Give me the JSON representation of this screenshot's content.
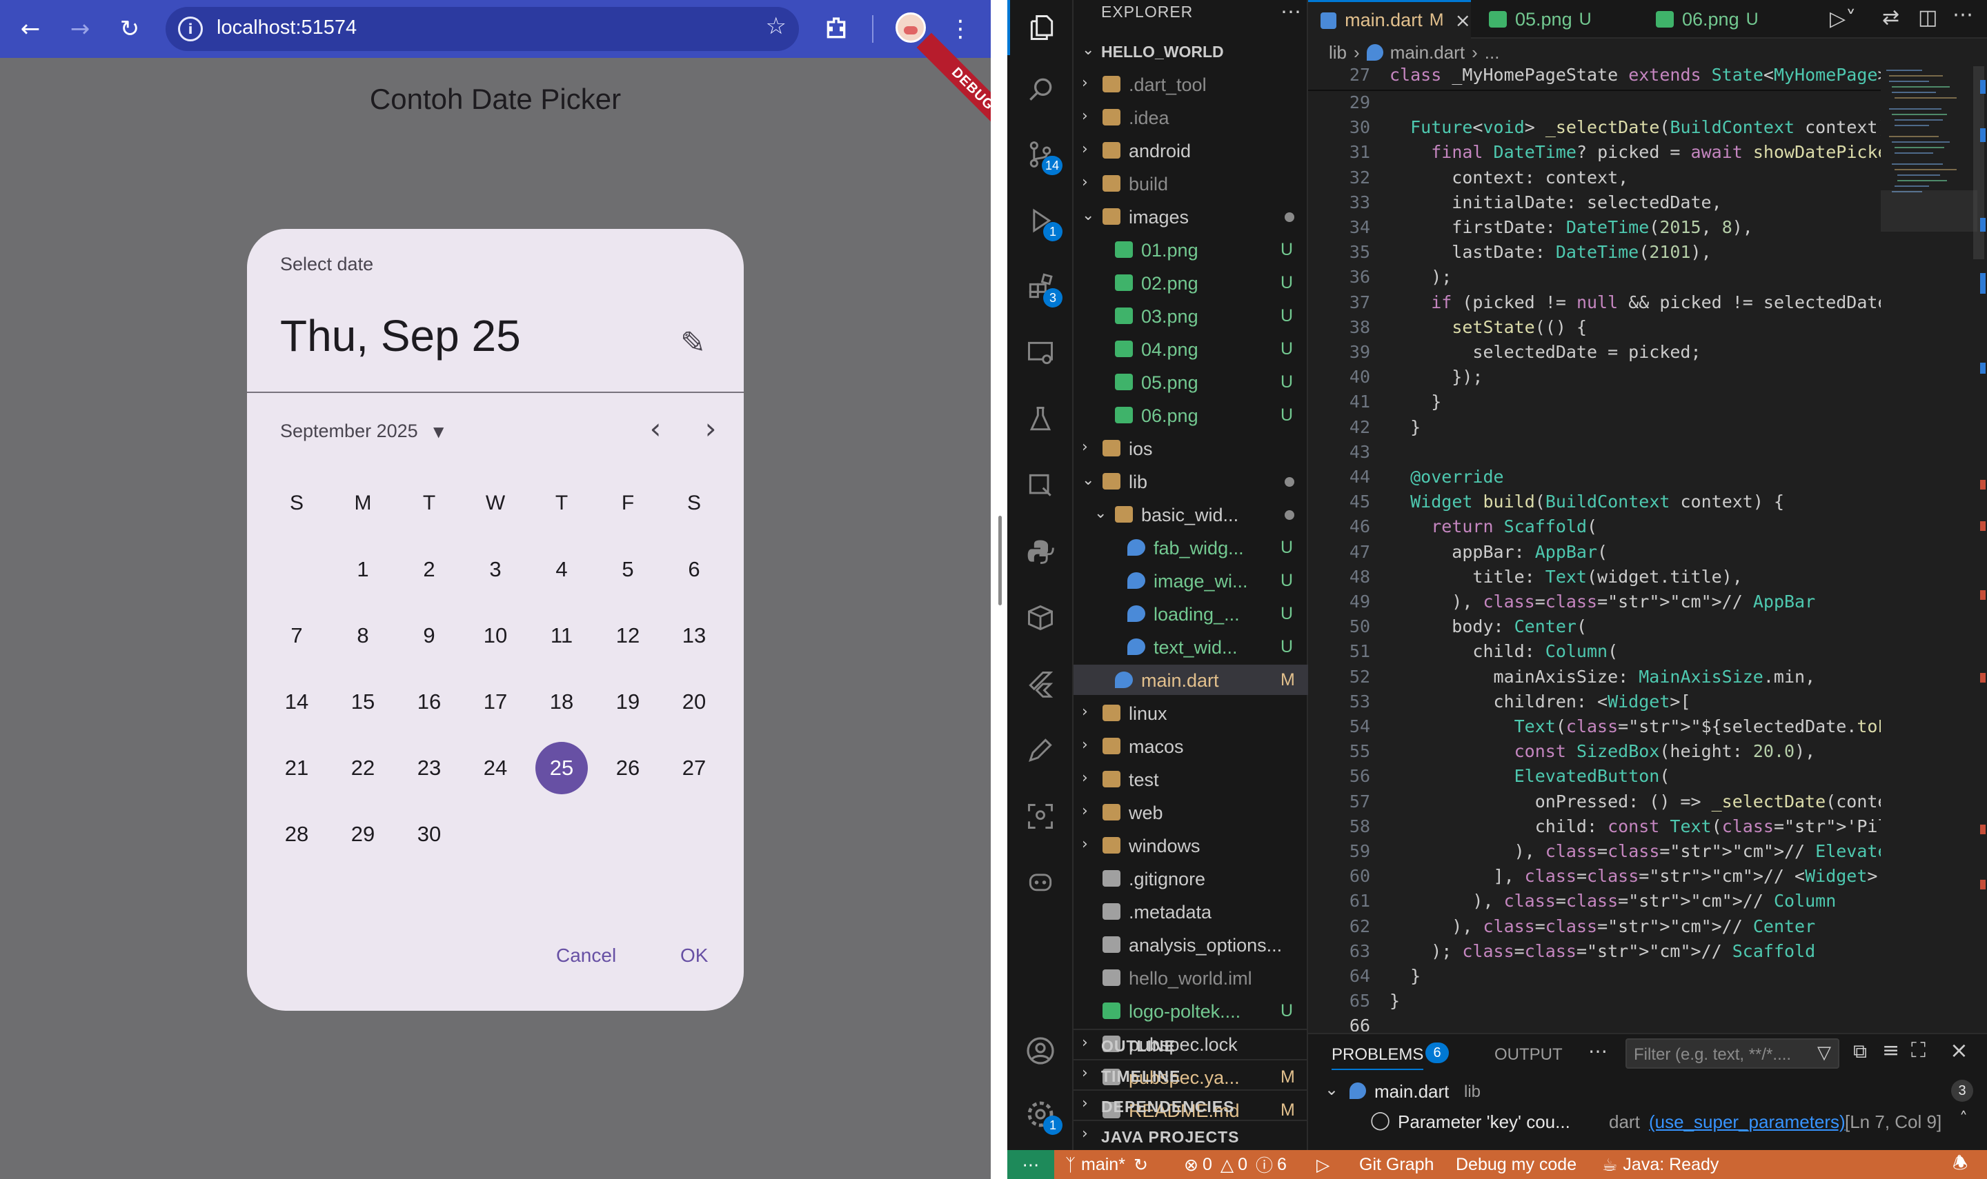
{
  "browser": {
    "url": "localhost:51574",
    "app_title": "Contoh Date Picker",
    "debug_label": "DEBUG",
    "icons": [
      "back-icon",
      "forward-icon",
      "reload-icon",
      "site-info-icon",
      "star-icon",
      "extensions-icon",
      "profile-avatar",
      "menu-icon"
    ]
  },
  "date_picker": {
    "heading": "Select date",
    "selected_display": "Thu, Sep 25",
    "month_label": "September 2025",
    "weekdays": [
      "S",
      "M",
      "T",
      "W",
      "T",
      "F",
      "S"
    ],
    "days": [
      "",
      "1",
      "2",
      "3",
      "4",
      "5",
      "6",
      "7",
      "8",
      "9",
      "10",
      "11",
      "12",
      "13",
      "14",
      "15",
      "16",
      "17",
      "18",
      "19",
      "20",
      "21",
      "22",
      "23",
      "24",
      "25",
      "26",
      "27",
      "28",
      "29",
      "30"
    ],
    "selected_day": "25",
    "cancel_label": "Cancel",
    "ok_label": "OK",
    "accent_color": "#6750a4"
  },
  "vscode": {
    "explorer_title": "EXPLORER",
    "root": "HELLO_WORLD",
    "activity_badges": {
      "source_control": "14",
      "run": "1",
      "extensions": "3",
      "settings": "1"
    },
    "tree": [
      {
        "label": ".dart_tool",
        "type": "folder",
        "badge": ""
      },
      {
        "label": ".idea",
        "type": "folder",
        "badge": ""
      },
      {
        "label": "android",
        "type": "folder",
        "badge": ""
      },
      {
        "label": "build",
        "type": "folder",
        "badge": ""
      },
      {
        "label": "images",
        "type": "folder-open",
        "badge": "dot"
      },
      {
        "label": "01.png",
        "type": "image",
        "badge": "U"
      },
      {
        "label": "02.png",
        "type": "image",
        "badge": "U"
      },
      {
        "label": "03.png",
        "type": "image",
        "badge": "U"
      },
      {
        "label": "04.png",
        "type": "image",
        "badge": "U"
      },
      {
        "label": "05.png",
        "type": "image",
        "badge": "U"
      },
      {
        "label": "06.png",
        "type": "image",
        "badge": "U"
      },
      {
        "label": "ios",
        "type": "folder",
        "badge": ""
      },
      {
        "label": "lib",
        "type": "folder-open",
        "badge": "dot"
      },
      {
        "label": "basic_wid...",
        "type": "folder-open",
        "badge": "dot"
      },
      {
        "label": "fab_widg...",
        "type": "dart",
        "badge": "U"
      },
      {
        "label": "image_wi...",
        "type": "dart",
        "badge": "U"
      },
      {
        "label": "loading_...",
        "type": "dart",
        "badge": "U"
      },
      {
        "label": "text_wid...",
        "type": "dart",
        "badge": "U"
      },
      {
        "label": "main.dart",
        "type": "dart",
        "badge": "M"
      },
      {
        "label": "linux",
        "type": "folder",
        "badge": ""
      },
      {
        "label": "macos",
        "type": "folder",
        "badge": ""
      },
      {
        "label": "test",
        "type": "folder",
        "badge": ""
      },
      {
        "label": "web",
        "type": "folder",
        "badge": ""
      },
      {
        "label": "windows",
        "type": "folder",
        "badge": ""
      },
      {
        "label": ".gitignore",
        "type": "file",
        "badge": ""
      },
      {
        "label": ".metadata",
        "type": "file",
        "badge": ""
      },
      {
        "label": "analysis_options...",
        "type": "file",
        "badge": ""
      },
      {
        "label": "hello_world.iml",
        "type": "file",
        "badge": ""
      },
      {
        "label": "logo-poltek....",
        "type": "image",
        "badge": "U"
      },
      {
        "label": "pubspec.lock",
        "type": "file",
        "badge": ""
      },
      {
        "label": "pubspec.ya...",
        "type": "file",
        "badge": "M"
      },
      {
        "label": "README.md",
        "type": "file",
        "badge": "M"
      }
    ],
    "sections": [
      "OUTLINE",
      "TIMELINE",
      "DEPENDENCIES",
      "JAVA PROJECTS"
    ],
    "tabs": [
      {
        "label": "main.dart",
        "status": "M"
      },
      {
        "label": "05.png",
        "status": "U"
      },
      {
        "label": "06.png",
        "status": "U"
      }
    ],
    "breadcrumb": [
      "lib",
      "main.dart",
      "..."
    ],
    "sticky_line": {
      "num": "27",
      "text": "class _MyHomePageState extends State<MyHomePage>"
    },
    "code_lines": [
      {
        "num": "29",
        "text": ""
      },
      {
        "num": "30",
        "text": "  Future<void> _selectDate(BuildContext context)"
      },
      {
        "num": "31",
        "text": "    final DateTime? picked = await showDatePicker"
      },
      {
        "num": "32",
        "text": "      context: context,"
      },
      {
        "num": "33",
        "text": "      initialDate: selectedDate,"
      },
      {
        "num": "34",
        "text": "      firstDate: DateTime(2015, 8),"
      },
      {
        "num": "35",
        "text": "      lastDate: DateTime(2101),"
      },
      {
        "num": "36",
        "text": "    );"
      },
      {
        "num": "37",
        "text": "    if (picked != null && picked != selectedDate)"
      },
      {
        "num": "38",
        "text": "      setState(() {"
      },
      {
        "num": "39",
        "text": "        selectedDate = picked;"
      },
      {
        "num": "40",
        "text": "      });"
      },
      {
        "num": "41",
        "text": "    }"
      },
      {
        "num": "42",
        "text": "  }"
      },
      {
        "num": "43",
        "text": ""
      },
      {
        "num": "44",
        "text": "  @override"
      },
      {
        "num": "45",
        "text": "  Widget build(BuildContext context) {"
      },
      {
        "num": "46",
        "text": "    return Scaffold("
      },
      {
        "num": "47",
        "text": "      appBar: AppBar("
      },
      {
        "num": "48",
        "text": "        title: Text(widget.title),"
      },
      {
        "num": "49",
        "text": "      ), // AppBar"
      },
      {
        "num": "50",
        "text": "      body: Center("
      },
      {
        "num": "51",
        "text": "        child: Column("
      },
      {
        "num": "52",
        "text": "          mainAxisSize: MainAxisSize.min,"
      },
      {
        "num": "53",
        "text": "          children: <Widget>["
      },
      {
        "num": "54",
        "text": "            Text(\"${selectedDate.toLocal()}\".spli"
      },
      {
        "num": "55",
        "text": "            const SizedBox(height: 20.0),"
      },
      {
        "num": "56",
        "text": "            ElevatedButton("
      },
      {
        "num": "57",
        "text": "              onPressed: () => _selectDate(contex"
      },
      {
        "num": "58",
        "text": "              child: const Text('Pilih Tanggal'),"
      },
      {
        "num": "59",
        "text": "            ), // ElevatedButton"
      },
      {
        "num": "60",
        "text": "          ], // <Widget>[]"
      },
      {
        "num": "61",
        "text": "        ), // Column"
      },
      {
        "num": "62",
        "text": "      ), // Center"
      },
      {
        "num": "63",
        "text": "    ); // Scaffold"
      },
      {
        "num": "64",
        "text": "  }"
      },
      {
        "num": "65",
        "text": "}"
      },
      {
        "num": "66",
        "text": ""
      }
    ],
    "panel": {
      "problems_label": "PROBLEMS",
      "problems_count": "6",
      "output_label": "OUTPUT",
      "filter_placeholder": "Filter (e.g. text, **/*....",
      "file_label": "main.dart",
      "file_dir": "lib",
      "file_count": "3",
      "problem_text": "Parameter 'key' cou...",
      "problem_source": "dart",
      "problem_link": "(use_super_parameters)",
      "problem_pos": "[Ln 7, Col 9]"
    },
    "status_bar": {
      "branch": "main*",
      "errors": "0",
      "warnings": "0",
      "infos": "6",
      "git_graph": "Git Graph",
      "debug": "Debug my code",
      "java": "Java: Ready",
      "color": "#cc6633"
    }
  }
}
